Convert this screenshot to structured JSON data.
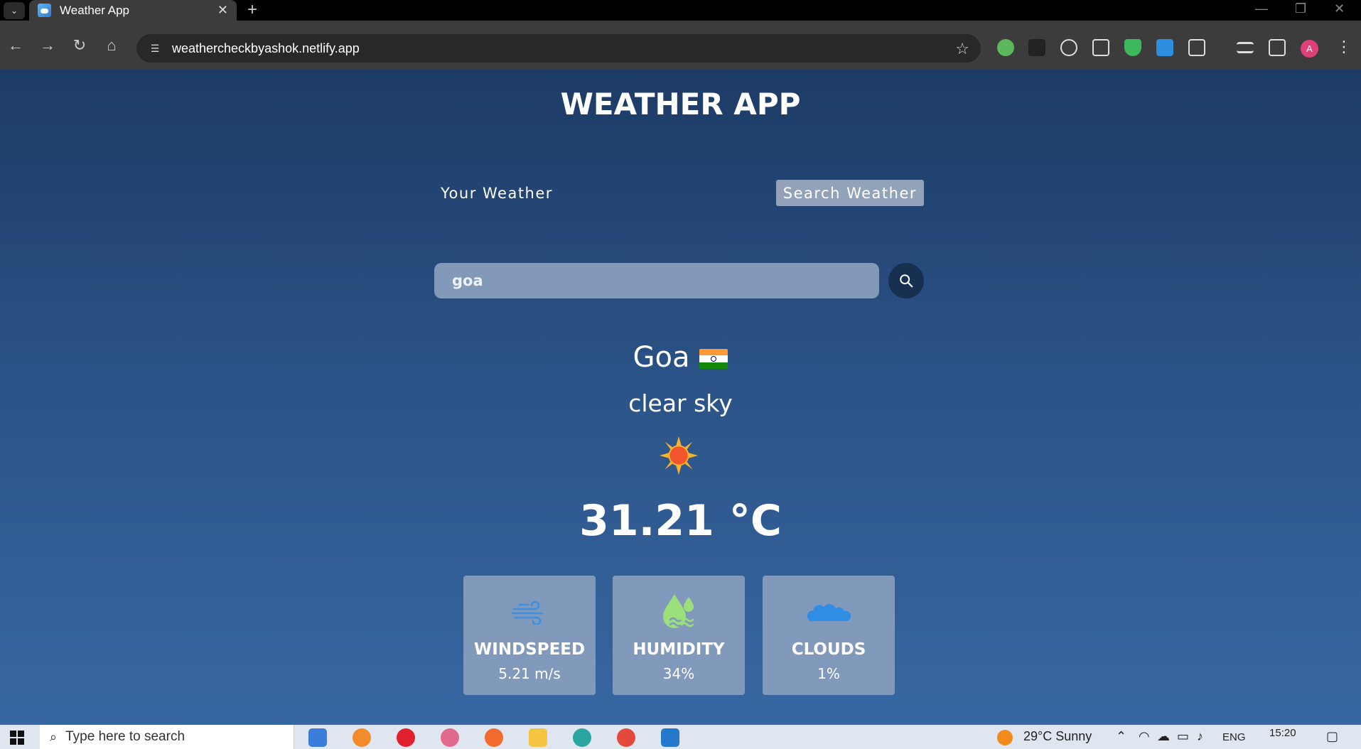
{
  "browser": {
    "tab_title": "Weather App",
    "url": "weathercheckbyashok.netlify.app",
    "avatar_letter": "A"
  },
  "app": {
    "title": "WEATHER APP",
    "tabs": {
      "your_weather": "Your Weather",
      "search_weather": "Search Weather"
    },
    "search": {
      "value": "goa"
    },
    "city": "Goa",
    "country_flag": "india-flag",
    "description": "clear sky",
    "weather_icon": "sun-icon",
    "temperature": "31.21 °C",
    "cards": [
      {
        "label": "WINDSPEED",
        "value": "5.21 m/s",
        "icon": "wind-icon"
      },
      {
        "label": "HUMIDITY",
        "value": "34%",
        "icon": "humidity-icon"
      },
      {
        "label": "CLOUDS",
        "value": "1%",
        "icon": "cloud-icon"
      }
    ],
    "colors": {
      "accent_card": "#8199ba",
      "search_btn": "#18304f"
    }
  },
  "taskbar": {
    "search_placeholder": "Type here to search",
    "weather": "29°C  Sunny",
    "language": "ENG",
    "time": "15:20"
  }
}
